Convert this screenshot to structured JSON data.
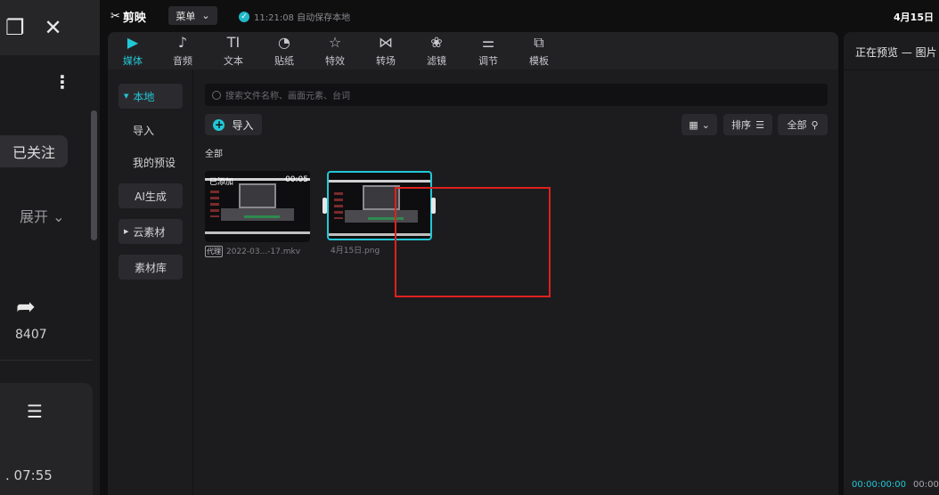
{
  "left_app": {
    "follow_label": "已关注",
    "expand_label": "展开",
    "share_count": "8407",
    "time_label": "07:55"
  },
  "titlebar": {
    "app_name": "剪映",
    "menu_label": "菜单",
    "save_status": "11:21:08 自动保存本地",
    "date": "4月15日"
  },
  "tool_tabs": [
    {
      "label": "媒体",
      "icon": "media-icon"
    },
    {
      "label": "音频",
      "icon": "audio-icon"
    },
    {
      "label": "文本",
      "icon": "text-icon"
    },
    {
      "label": "贴纸",
      "icon": "sticker-icon"
    },
    {
      "label": "特效",
      "icon": "effects-icon"
    },
    {
      "label": "转场",
      "icon": "transition-icon"
    },
    {
      "label": "滤镜",
      "icon": "filter-icon"
    },
    {
      "label": "调节",
      "icon": "adjust-icon"
    },
    {
      "label": "模板",
      "icon": "template-icon"
    }
  ],
  "subnav": {
    "local": "本地",
    "import": "导入",
    "my_presets": "我的预设",
    "ai_generate": "AI生成",
    "cloud": "云素材",
    "library": "素材库"
  },
  "content": {
    "search_placeholder": "搜索文件名称、画面元素、台词",
    "import_label": "导入",
    "sort_label": "排序",
    "filter_label": "全部",
    "section_label": "全部"
  },
  "media": [
    {
      "added_tag": "已添加",
      "duration": "00:05",
      "proxy_tag": "代理",
      "filename": "2022-03...-17.mkv",
      "selected": false
    },
    {
      "filename": "4月15日.png",
      "selected": true
    }
  ],
  "preview": {
    "title": "正在预览 — 图片",
    "current_time": "00:00:00:00",
    "total_time": "00:00"
  },
  "colors": {
    "accent": "#22c7d6",
    "highlight_box": "#e0201e"
  }
}
